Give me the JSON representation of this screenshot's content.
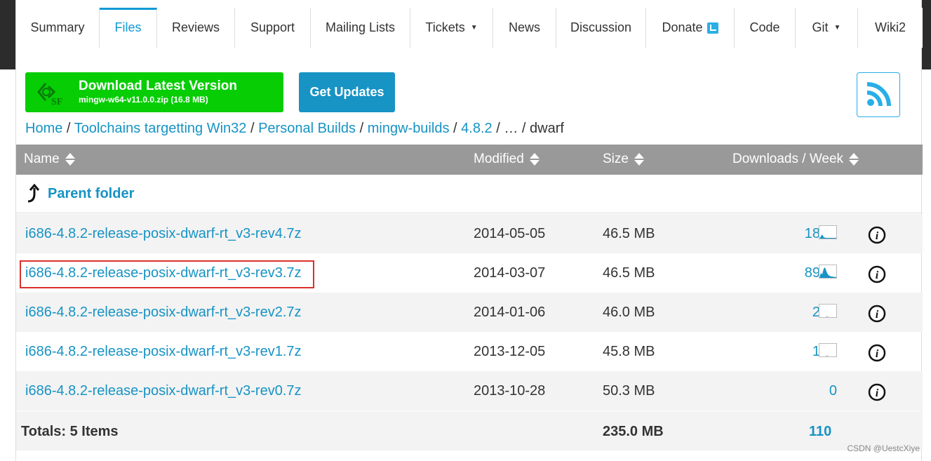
{
  "tabs": [
    {
      "label": "Summary",
      "active": false
    },
    {
      "label": "Files",
      "active": true
    },
    {
      "label": "Reviews",
      "active": false
    },
    {
      "label": "Support",
      "active": false
    },
    {
      "label": "Mailing Lists",
      "active": false
    },
    {
      "label": "Tickets",
      "active": false,
      "dropdown": true
    },
    {
      "label": "News",
      "active": false
    },
    {
      "label": "Discussion",
      "active": false
    },
    {
      "label": "Donate",
      "active": false
    },
    {
      "label": "Code",
      "active": false
    },
    {
      "label": "Git",
      "active": false,
      "dropdown": true
    },
    {
      "label": "Wiki2",
      "active": false
    }
  ],
  "download": {
    "title": "Download Latest Version",
    "file": "mingw-w64-v11.0.0.zip (16.8 MB)",
    "color": "#06cd04"
  },
  "updates_label": "Get Updates",
  "rss_icon": "rss-icon",
  "breadcrumb": {
    "links": [
      "Home",
      "Toolchains targetting Win32",
      "Personal Builds",
      "mingw-builds",
      "4.8.2"
    ],
    "ellipsis": "…",
    "current": "dwarf",
    "sep": "/"
  },
  "table": {
    "headers": {
      "name": "Name",
      "modified": "Modified",
      "size": "Size",
      "downloads": "Downloads / Week"
    },
    "parent": "Parent folder",
    "rows": [
      {
        "name": "i686-4.8.2-release-posix-dwarf-rt_v3-rev4.7z",
        "modified": "2014-05-05",
        "size": "46.5 MB",
        "downloads": "18",
        "highlighted": false
      },
      {
        "name": "i686-4.8.2-release-posix-dwarf-rt_v3-rev3.7z",
        "modified": "2014-03-07",
        "size": "46.5 MB",
        "downloads": "89",
        "highlighted": true
      },
      {
        "name": "i686-4.8.2-release-posix-dwarf-rt_v3-rev2.7z",
        "modified": "2014-01-06",
        "size": "46.0 MB",
        "downloads": "2",
        "highlighted": false
      },
      {
        "name": "i686-4.8.2-release-posix-dwarf-rt_v3-rev1.7z",
        "modified": "2013-12-05",
        "size": "45.8 MB",
        "downloads": "1",
        "highlighted": false
      },
      {
        "name": "i686-4.8.2-release-posix-dwarf-rt_v3-rev0.7z",
        "modified": "2013-10-28",
        "size": "50.3 MB",
        "downloads": "0",
        "highlighted": false
      }
    ],
    "totals": {
      "label": "Totals: 5 Items",
      "size": "235.0 MB",
      "downloads": "110"
    }
  },
  "watermark": "CSDN @UestcXiye",
  "colors": {
    "link": "#1793c4",
    "header_bg": "#999999",
    "highlight_border": "#d9312d",
    "accent": "#0f9ad6"
  }
}
